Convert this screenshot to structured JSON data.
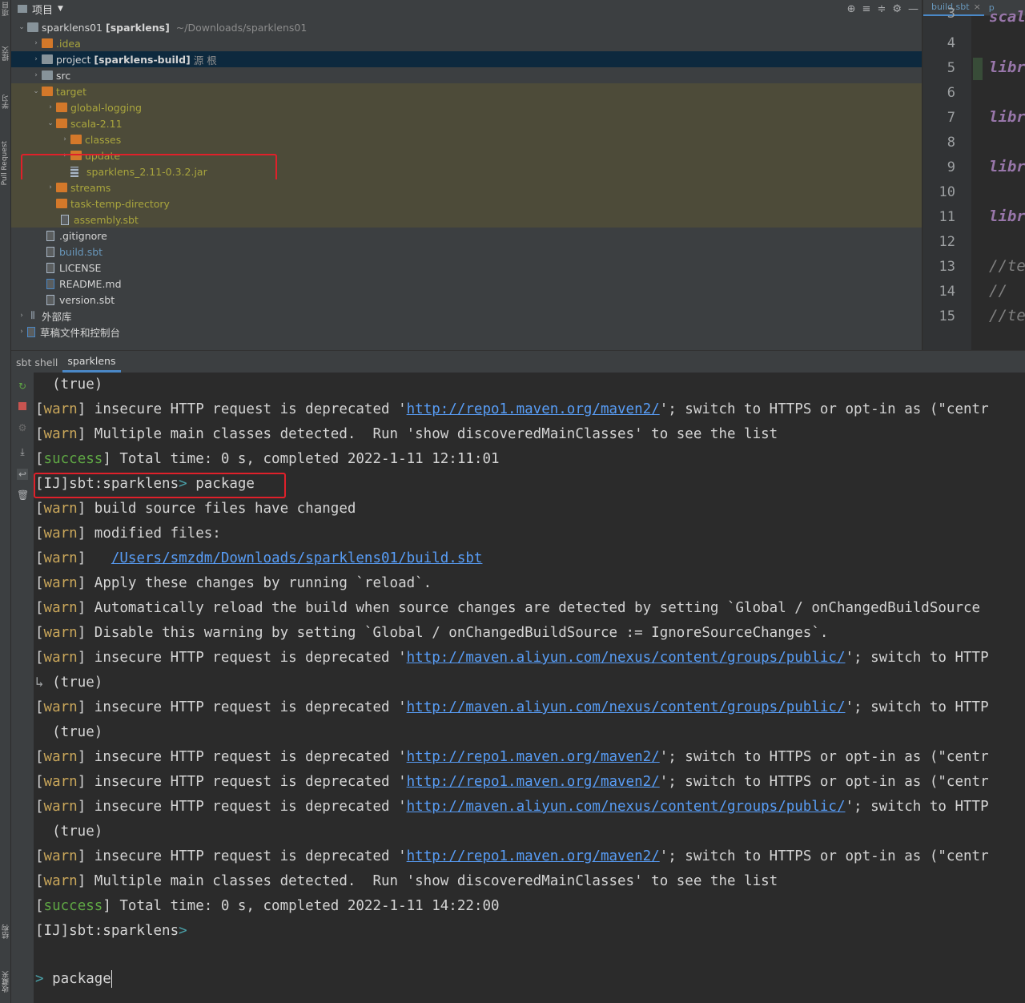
{
  "left_strip": {
    "tabs": [
      "项目",
      "提交",
      "学习",
      "Pull Request",
      "结构",
      "收藏夹"
    ]
  },
  "project_panel": {
    "title": "项目",
    "root": {
      "name": "sparklens01",
      "module": "[sparklens]",
      "path": "~/Downloads/sparklens01"
    },
    "items": [
      {
        "label": ".idea"
      },
      {
        "label": "project",
        "module": "[sparklens-build]",
        "suffix": "源 根"
      },
      {
        "label": "src"
      },
      {
        "label": "target"
      },
      {
        "label": "global-logging"
      },
      {
        "label": "scala-2.11"
      },
      {
        "label": "classes"
      },
      {
        "label": "update"
      },
      {
        "label": "sparklens_2.11-0.3.2.jar"
      },
      {
        "label": "streams"
      },
      {
        "label": "task-temp-directory"
      },
      {
        "label": "assembly.sbt"
      },
      {
        "label": ".gitignore"
      },
      {
        "label": "build.sbt"
      },
      {
        "label": "LICENSE"
      },
      {
        "label": "README.md"
      },
      {
        "label": "version.sbt"
      },
      {
        "label": "外部库"
      },
      {
        "label": "草稿文件和控制台"
      }
    ]
  },
  "editor": {
    "tabs": [
      "build.sbt",
      "p"
    ],
    "line_numbers": [
      "3",
      "4",
      "5",
      "6",
      "7",
      "8",
      "9",
      "10",
      "11",
      "12",
      "13",
      "14",
      "15"
    ],
    "code": {
      "l3": "scal",
      "l5": "libr",
      "l7": "libr",
      "l9": "libr",
      "l11": "libr",
      "l13": "//te",
      "l14": "//",
      "l15": "//te"
    }
  },
  "tool_window": {
    "tabs": [
      "sbt shell",
      "sparklens"
    ]
  },
  "console": {
    "warn_tag": "warn",
    "success_tag": "success",
    "true_text": "(true)",
    "repo1_url": "http://repo1.maven.org/maven2/",
    "aliyun_url": "http://maven.aliyun.com/nexus/content/groups/public/",
    "insecure_prefix": " insecure HTTP request is deprecated '",
    "repo1_suffix": "'; switch to HTTPS or opt-in as (\"centr",
    "aliyun_suffix": "'; switch to HTTP",
    "multiple_main": " Multiple main classes detected.  Run 'show discoveredMainClasses' to see the list",
    "total_time_1": " Total time: 0 s, completed 2022-1-11 12:11:01",
    "total_time_2": " Total time: 0 s, completed 2022-1-11 14:22:00",
    "prompt": "[IJ]sbt:sparklens",
    "prompt_arrow": ">",
    "command": " package",
    "build_changed": " build source files have changed",
    "modified_files": " modified files:",
    "modified_path": "/Users/smzdm/Downloads/sparklens01/build.sbt",
    "apply_changes": " Apply these changes by running `reload`.",
    "auto_reload": " Automatically reload the build when source changes are detected by setting `Global / onChangedBuildSource",
    "disable_warning": " Disable this warning by setting `Global / onChangedBuildSource := IgnoreSourceChanges`.",
    "input_arrow": ">",
    "input_value": "package"
  }
}
